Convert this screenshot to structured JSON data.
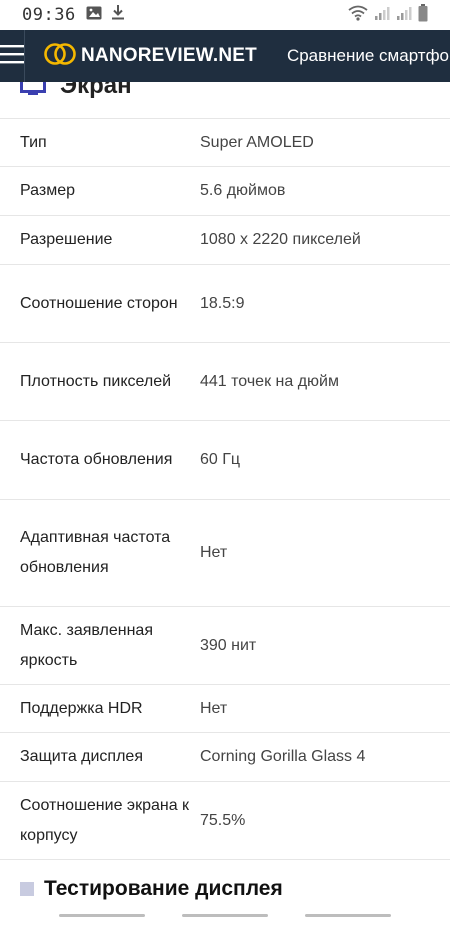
{
  "status": {
    "time": "09:36"
  },
  "header": {
    "logo_text": "NANOREVIEW.NET",
    "nav_link": "Сравнение смартфонов",
    "brand_color": "#1f2e3f",
    "accent_color": "#f5b800"
  },
  "section": {
    "title": "Экран"
  },
  "specs": [
    {
      "label": "Тип",
      "value": "Super AMOLED"
    },
    {
      "label": "Размер",
      "value": "5.6 дюймов"
    },
    {
      "label": "Разрешение",
      "value": "1080 x 2220 пикселей"
    },
    {
      "label": "Соотношение сторон",
      "value": "18.5:9"
    },
    {
      "label": "Плотность пикселей",
      "value": "441 точек на дюйм"
    },
    {
      "label": "Частота обновления",
      "value": "60 Гц"
    },
    {
      "label": "Адаптивная частота обновления",
      "value": "Нет"
    },
    {
      "label": "Макс. заявленная яркость",
      "value": "390 нит"
    },
    {
      "label": "Поддержка HDR",
      "value": "Нет"
    },
    {
      "label": "Защита дисплея",
      "value": "Corning Gorilla Glass 4"
    },
    {
      "label": "Соотношение экрана к корпусу",
      "value": "75.5%"
    }
  ],
  "next_section": {
    "title": "Тестирование дисплея"
  },
  "icons": {
    "menu": "hamburger-menu-icon",
    "screen": "monitor-icon",
    "image": "image-icon",
    "download": "download-icon",
    "wifi": "wifi-icon",
    "signal": "signal-icon",
    "battery": "battery-icon"
  }
}
